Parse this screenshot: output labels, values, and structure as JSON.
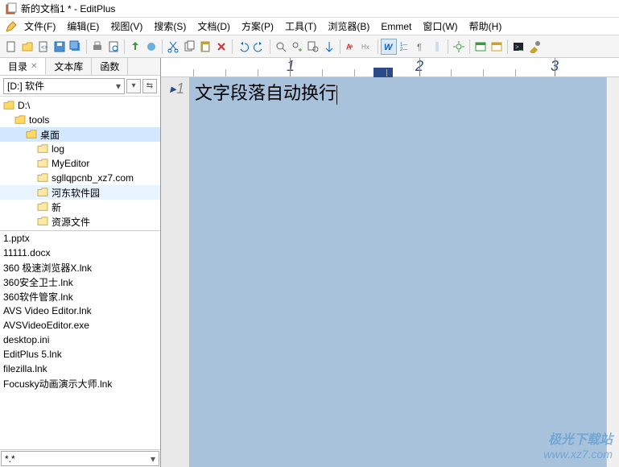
{
  "title": "新的文档1 * - EditPlus",
  "menu": {
    "file": "文件(F)",
    "edit": "编辑(E)",
    "view": "视图(V)",
    "search": "搜索(S)",
    "document": "文档(D)",
    "project": "方案(P)",
    "tools": "工具(T)",
    "browser": "浏览器(B)",
    "emmet": "Emmet",
    "window": "窗口(W)",
    "help": "帮助(H)"
  },
  "sidebar": {
    "tabs": {
      "dir": "目录",
      "clip": "文本库",
      "func": "函数"
    },
    "drive": "[D:] 软件",
    "tree": [
      {
        "label": "D:\\",
        "depth": 0,
        "open": true
      },
      {
        "label": "tools",
        "depth": 1,
        "open": true
      },
      {
        "label": "桌面",
        "depth": 2,
        "open": true,
        "selected": true
      },
      {
        "label": "log",
        "depth": 3
      },
      {
        "label": "MyEditor",
        "depth": 3
      },
      {
        "label": "sgllqpcnb_xz7.com",
        "depth": 3
      },
      {
        "label": "河东软件园",
        "depth": 3,
        "hl": true
      },
      {
        "label": "新",
        "depth": 3
      },
      {
        "label": "资源文件",
        "depth": 3
      }
    ],
    "files": [
      "1.pptx",
      "11111.docx",
      "360 极速浏览器X.lnk",
      "360安全卫士.lnk",
      "360软件管家.lnk",
      "AVS Video Editor.lnk",
      "AVSVideoEditor.exe",
      "desktop.ini",
      "EditPlus 5.lnk",
      "filezilla.lnk",
      "Focusky动画演示大师.lnk"
    ],
    "filter": "*.*"
  },
  "ruler": {
    "marks": [
      "1",
      "2",
      "3"
    ]
  },
  "editor": {
    "line_number": "1",
    "text": "文字段落自动换行"
  },
  "watermark": {
    "brand": "极光下载站",
    "url": "www.xz7.com"
  }
}
